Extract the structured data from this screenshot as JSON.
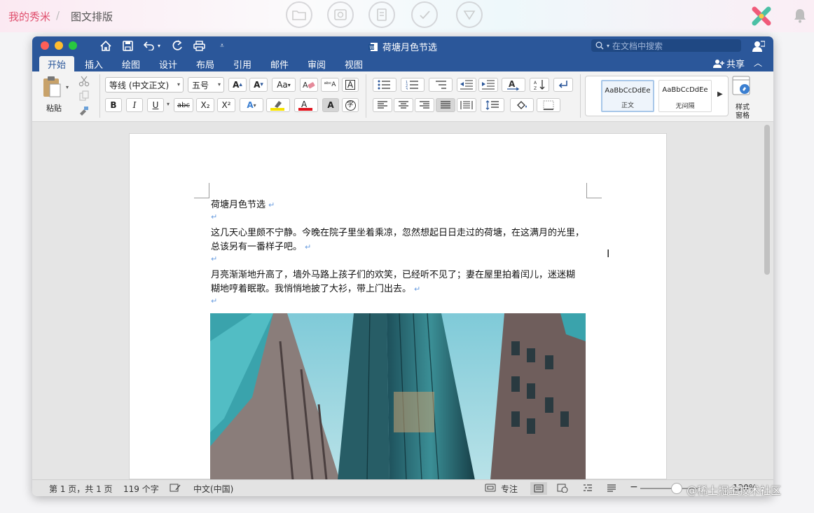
{
  "site": {
    "breadcrumb_home": "我的秀米",
    "breadcrumb_sep": "/",
    "breadcrumb_current": "图文排版"
  },
  "window": {
    "title": "荷塘月色节选",
    "search_placeholder": "在文档中搜索",
    "share_label": "共享"
  },
  "tabs": [
    "开始",
    "插入",
    "绘图",
    "设计",
    "布局",
    "引用",
    "邮件",
    "审阅",
    "视图"
  ],
  "ribbon": {
    "paste_label": "粘贴",
    "font_name": "等线 (中文正文)",
    "font_size": "五号",
    "bold": "B",
    "italic": "I",
    "underline": "U",
    "strike": "abc",
    "subscript": "X₂",
    "superscript": "X²",
    "styles": [
      {
        "sample": "AaBbCcDdEe",
        "name": "正文"
      },
      {
        "sample": "AaBbCcDdEe",
        "name": "无间隔"
      }
    ],
    "style_pane_label_1": "样式",
    "style_pane_label_2": "窗格"
  },
  "document": {
    "title": "荷塘月色节选",
    "para1_line1": "这几天心里颇不宁静。今晚在院子里坐着乘凉，忽然想起日日走过的荷塘，在这满月的光里，",
    "para1_line2": "总该另有一番样子吧。",
    "para2_line1": "月亮渐渐地升高了，墙外马路上孩子们的欢笑，已经听不见了；妻在屋里拍着闰儿，迷迷糊",
    "para2_line2": "糊地哼着眠歌。我悄悄地披了大衫，带上门出去。",
    "return_mark": "↵"
  },
  "status": {
    "page": "第 1 页，共 1 页",
    "words": "119 个字",
    "language": "中文(中国)",
    "focus": "专注",
    "zoom": "120%"
  },
  "watermark": "@稀土掘金技术社区",
  "colors": {
    "word_blue": "#2b579a",
    "brand_pink": "#e0506e",
    "return_mark": "#6a9de0"
  }
}
